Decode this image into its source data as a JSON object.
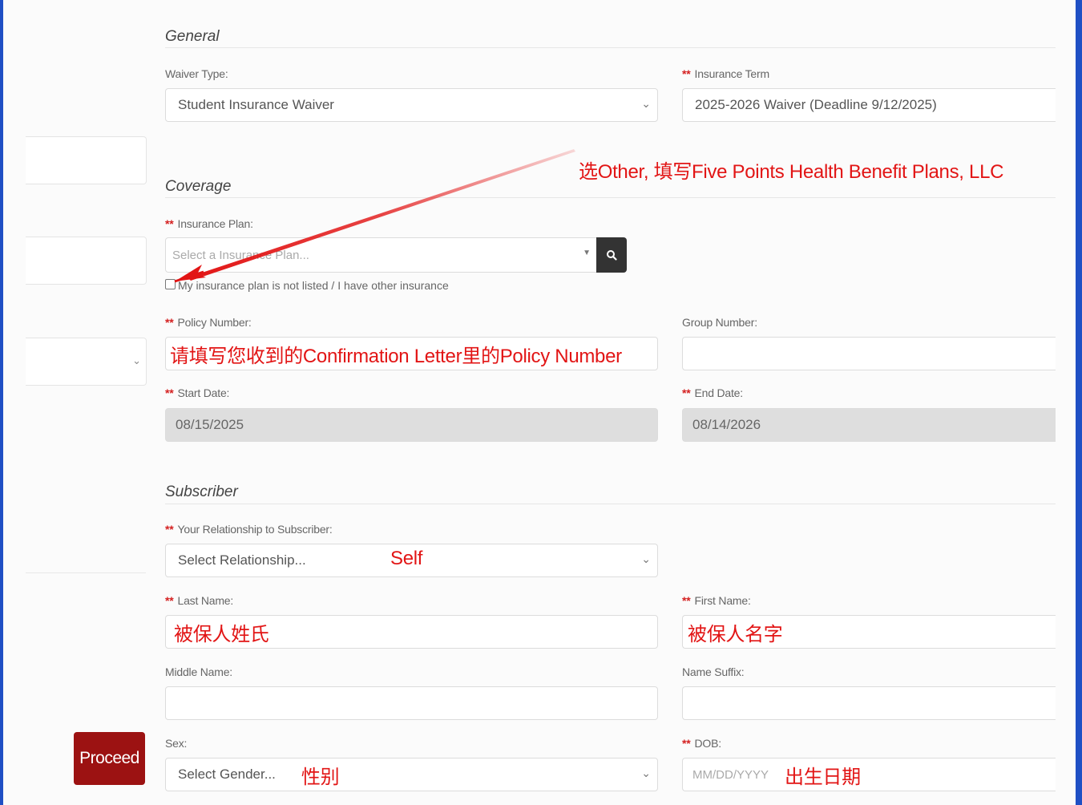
{
  "left": {
    "proceed_label": "Proceed"
  },
  "sections": {
    "general": "General",
    "coverage": "Coverage",
    "subscriber": "Subscriber"
  },
  "general": {
    "waiver_type_label": "Waiver Type:",
    "waiver_type_value": "Student Insurance Waiver",
    "insurance_term_label": "Insurance Term",
    "insurance_term_value": "2025-2026 Waiver (Deadline 9/12/2025)"
  },
  "coverage": {
    "insurance_plan_label": "Insurance Plan:",
    "insurance_plan_placeholder": "Select a Insurance Plan...",
    "not_listed_label": "My insurance plan is not listed / I have other insurance",
    "policy_number_label": "Policy Number:",
    "group_number_label": "Group Number:",
    "start_date_label": "Start Date:",
    "start_date_value": "08/15/2025",
    "end_date_label": "End Date:",
    "end_date_value": "08/14/2026"
  },
  "subscriber": {
    "relationship_label": "Your Relationship to Subscriber:",
    "relationship_placeholder": "Select Relationship...",
    "last_name_label": "Last Name:",
    "first_name_label": "First Name:",
    "middle_name_label": "Middle Name:",
    "name_suffix_label": "Name Suffix:",
    "sex_label": "Sex:",
    "sex_placeholder": "Select Gender...",
    "dob_label": "DOB:",
    "dob_placeholder": "MM/DD/YYYY"
  },
  "annotations": {
    "insurance_plan": "选Other, 填写Five Points Health Benefit Plans, LLC",
    "policy_number": "请填写您收到的Confirmation Letter里的Policy Number",
    "relationship": "Self",
    "last_name": "被保人姓氏",
    "first_name": "被保人名字",
    "sex": "性别",
    "dob": "出生日期"
  },
  "required_marker": "**",
  "colors": {
    "annotation": "#e21515",
    "required": "#d42020",
    "proceed": "#9c1212",
    "frame": "#1f4fc4"
  }
}
